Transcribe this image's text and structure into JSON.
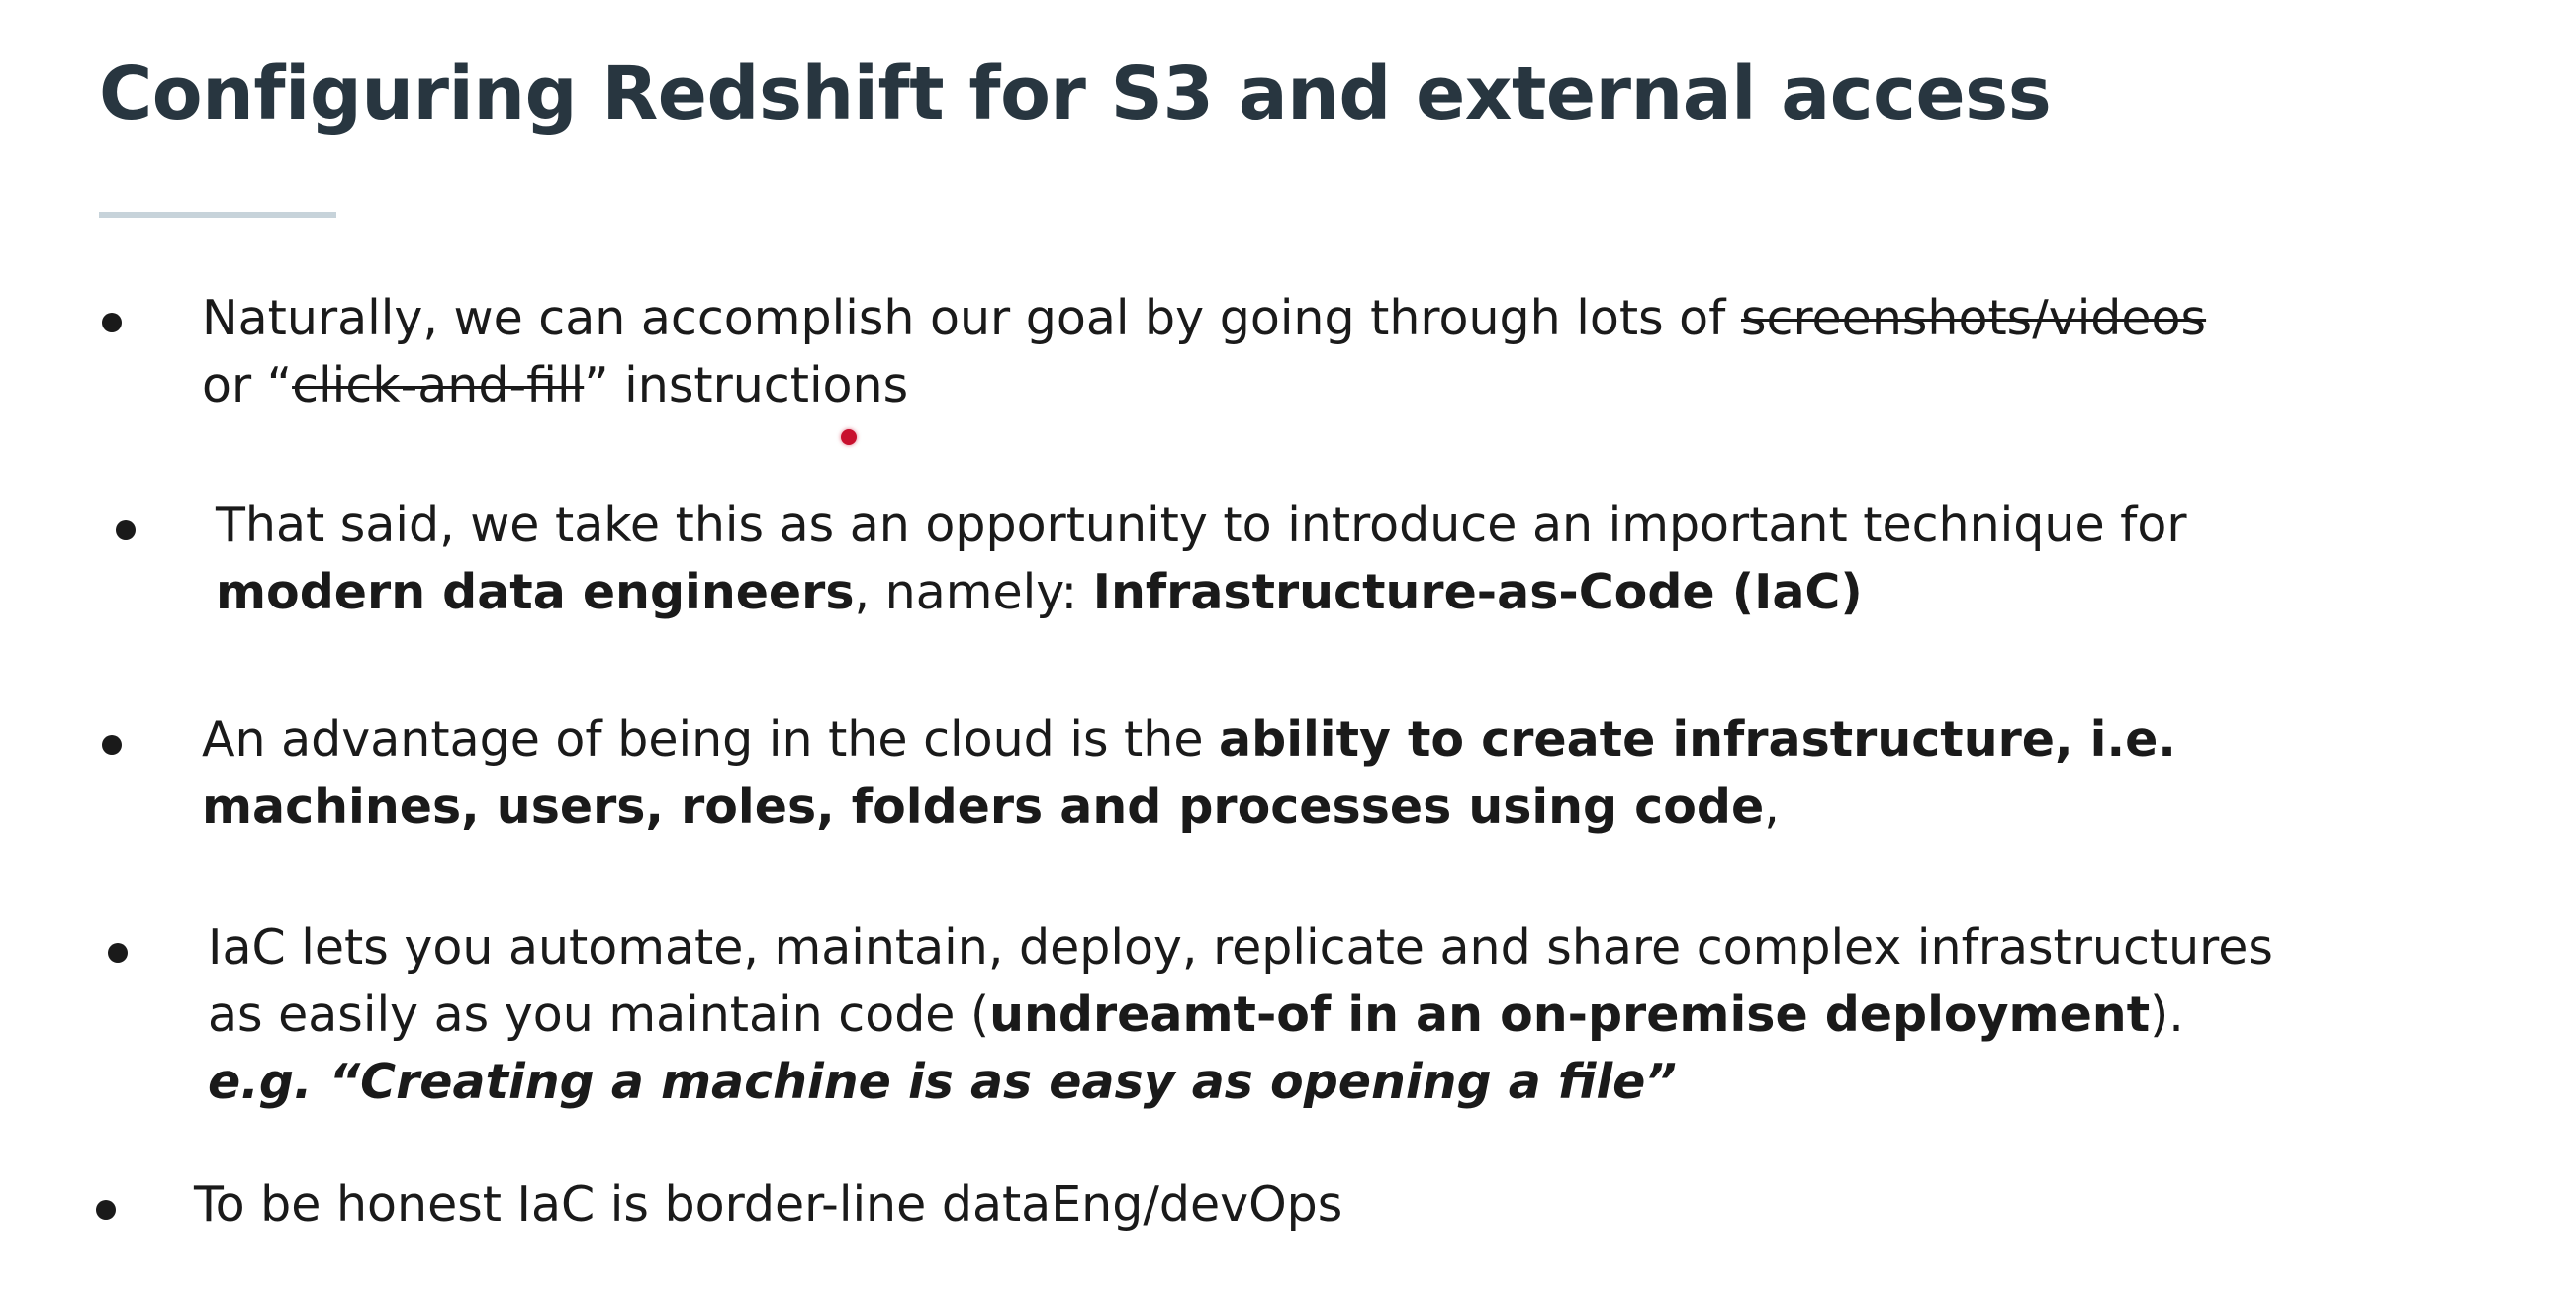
{
  "slide": {
    "title": "Configuring Redshift for S3 and external access",
    "bullets": [
      {
        "line1_a": "Naturally, we can accomplish our goal by going through lots of ",
        "line1_strike": "screenshots/videos",
        "line2_a": "or “",
        "line2_strike": "click-and-fill",
        "line2_b": "” instructions"
      },
      {
        "line1": "That said, we take this as an opportunity to introduce an important technique for",
        "line2_bold1": "modern data engineers",
        "line2_mid": ", namely: ",
        "line2_bold2": "Infrastructure-as-Code (IaC)"
      },
      {
        "line1_a": "An advantage of being in the cloud is the ",
        "line1_bold": "ability to create infrastructure, i.e.",
        "line2_bold": "machines, users, roles, folders and processes using code",
        "line2_b": ","
      },
      {
        "line1": "IaC lets you automate, maintain, deploy, replicate and share complex infrastructures",
        "line2_a": "as easily as you maintain code (",
        "line2_bold": "undreamt-of in an on-premise deployment",
        "line2_b": ").",
        "line3_bolditalic": "e.g. “Creating a machine is as easy as opening a file”"
      },
      {
        "line1": "To be honest IaC is border-line dataEng/devOps"
      }
    ]
  },
  "colors": {
    "title": "#283640",
    "text": "#1a1a1a",
    "rule": "#c7d3da",
    "pointer": "#c8102e"
  }
}
